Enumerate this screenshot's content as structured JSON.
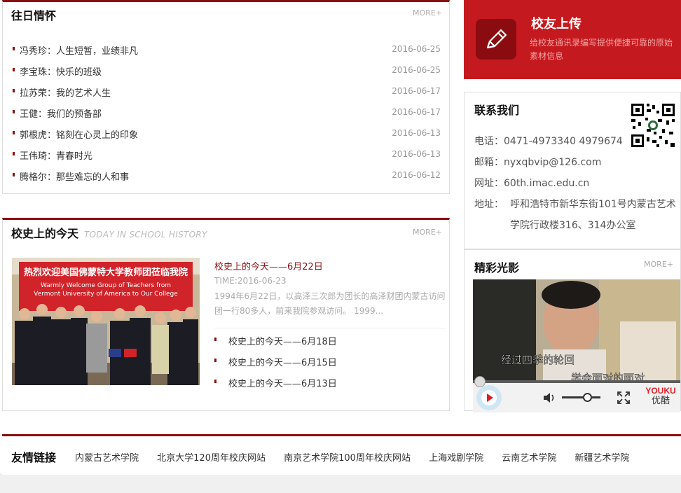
{
  "memories": {
    "title": "往日情怀",
    "more": "MORE+",
    "items": [
      {
        "text": "冯秀珍：人生短暂，业绩非凡",
        "date": "2016-06-25"
      },
      {
        "text": "李宝珠：快乐的班级",
        "date": "2016-06-25"
      },
      {
        "text": "拉苏荣：我的艺术人生",
        "date": "2016-06-17"
      },
      {
        "text": "王健：我们的预备部",
        "date": "2016-06-17"
      },
      {
        "text": "郭根虎：铭刻在心灵上的印象",
        "date": "2016-06-13"
      },
      {
        "text": "王伟琦：青春时光",
        "date": "2016-06-13"
      },
      {
        "text": "腾格尔：那些难忘的人和事",
        "date": "2016-06-12"
      }
    ]
  },
  "history": {
    "title": "校史上的今天",
    "subtitle": "TODAY IN SCHOOL HISTORY",
    "more": "MORE+",
    "photo_banner": "热烈欢迎美国佛蒙特大学教师团莅临我院",
    "photo_banner_en1": "Warmly Welcome Group of Teachers from",
    "photo_banner_en2": "Vermont University of America to Our College",
    "featured_title": "校史上的今天——6月22日",
    "featured_time": "TIME:2016-06-23",
    "featured_desc": "1994年6月22日，以高泽三次郎为团长的高泽财团内蒙古访问团一行80多人，前来我院参观访问。 1999...",
    "items": [
      "校史上的今天——6月18日",
      "校史上的今天——6月15日",
      "校史上的今天——6月13日"
    ]
  },
  "upload": {
    "title": "校友上传",
    "desc": "给校友通讯录编写提供便捷可靠的原始素材信息",
    "icon": "pencil-icon"
  },
  "contact": {
    "title": "联系我们",
    "phone": "电话：0471-4973340 4979674",
    "email": "邮箱：nyxqbvip@126.com",
    "website": "网址：60th.imac.edu.cn",
    "address_label": "地址：",
    "address_line1": "呼和浩特市新华东街101号内蒙古艺术",
    "address_line2": "学院行政楼316、314办公室"
  },
  "gallery": {
    "title": "精彩光影",
    "more": "MORE+",
    "subtitle_line1": "经过四季的轮回",
    "subtitle_line2": "学会面对的面对",
    "player_logo_1": "YOUKU",
    "player_logo_2": "优酷",
    "player_progress": 0.0,
    "player_volume": 0.7
  },
  "friends": {
    "title": "友情链接",
    "links": [
      "内蒙古艺术学院",
      "北京大学120周年校庆网站",
      "南京艺术学院100周年校庆网站",
      "上海戏剧学院",
      "云南艺术学院",
      "新疆艺术学院"
    ]
  },
  "colors": {
    "accent": "#8b0c10",
    "upload_bg": "#c41a1f",
    "page_bg": "#f0f0f0"
  }
}
